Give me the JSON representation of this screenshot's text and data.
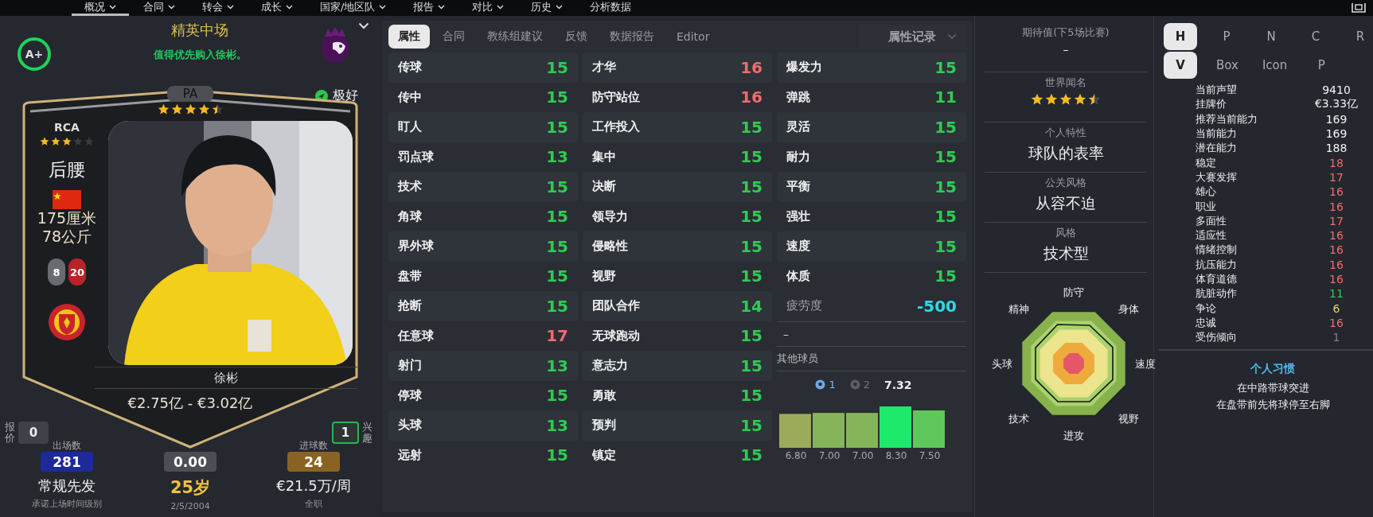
{
  "nav": [
    {
      "label": "概况",
      "selected": true,
      "dropdown": true
    },
    {
      "label": "合同",
      "selected": false,
      "dropdown": true
    },
    {
      "label": "转会",
      "selected": false,
      "dropdown": true
    },
    {
      "label": "成长",
      "selected": false,
      "dropdown": true
    },
    {
      "label": "国家/地区队",
      "selected": false,
      "dropdown": true
    },
    {
      "label": "报告",
      "selected": false,
      "dropdown": true
    },
    {
      "label": "对比",
      "selected": false,
      "dropdown": true
    },
    {
      "label": "历史",
      "selected": false,
      "dropdown": true
    },
    {
      "label": "分析数据",
      "selected": false,
      "dropdown": false
    }
  ],
  "player": {
    "grade": "A+",
    "role_title": "精英中场",
    "recommendation": "值得优先购入徐彬。",
    "pa": {
      "label": "PA",
      "stars": 4.5
    },
    "scout_rating": "极好",
    "position_rating": {
      "code": "RCA",
      "stars": 3
    },
    "position": "后腰",
    "height": "175厘米",
    "weight": "78公斤",
    "numbers": [
      {
        "value": "8",
        "color": "#6a6b70"
      },
      {
        "value": "20",
        "color": "#b82228"
      }
    ],
    "name": "徐彬",
    "value_range": "€2.75亿 - €3.02亿",
    "offers": {
      "label": "报价",
      "value": "0"
    },
    "interest": {
      "label": "兴趣",
      "value": "1"
    },
    "stats": [
      {
        "caption": "出场数",
        "badge": "281",
        "color": "#1d2a98",
        "main": "常规先发",
        "highlight": false,
        "sub": "承诺上场时间级别"
      },
      {
        "badge": "0.00",
        "color": "#4b4e55",
        "main": "25岁",
        "highlight": true,
        "sub": "2/5/2004"
      },
      {
        "caption": "进球数",
        "badge": "24",
        "color": "#8a6322",
        "main": "€21.5万/周",
        "highlight": false,
        "sub": "全职"
      }
    ]
  },
  "tabs": [
    {
      "label": "属性",
      "selected": true
    },
    {
      "label": "合同",
      "selected": false
    },
    {
      "label": "教练组建议",
      "selected": false
    },
    {
      "label": "反馈",
      "selected": false
    },
    {
      "label": "数据报告",
      "selected": false
    },
    {
      "label": "Editor",
      "selected": false
    }
  ],
  "history_dropdown": "属性记录",
  "attribute_columns": [
    [
      {
        "label": "传球",
        "value": "15"
      },
      {
        "label": "传中",
        "value": "15"
      },
      {
        "label": "盯人",
        "value": "15"
      },
      {
        "label": "罚点球",
        "value": "13"
      },
      {
        "label": "技术",
        "value": "15"
      },
      {
        "label": "角球",
        "value": "15"
      },
      {
        "label": "界外球",
        "value": "15"
      },
      {
        "label": "盘带",
        "value": "15"
      },
      {
        "label": "抢断",
        "value": "15"
      },
      {
        "label": "任意球",
        "value": "17"
      },
      {
        "label": "射门",
        "value": "13"
      },
      {
        "label": "停球",
        "value": "15"
      },
      {
        "label": "头球",
        "value": "13"
      },
      {
        "label": "远射",
        "value": "15"
      }
    ],
    [
      {
        "label": "才华",
        "value": "16"
      },
      {
        "label": "防守站位",
        "value": "16"
      },
      {
        "label": "工作投入",
        "value": "15"
      },
      {
        "label": "集中",
        "value": "15"
      },
      {
        "label": "决断",
        "value": "15"
      },
      {
        "label": "领导力",
        "value": "15"
      },
      {
        "label": "侵略性",
        "value": "15"
      },
      {
        "label": "视野",
        "value": "15"
      },
      {
        "label": "团队合作",
        "value": "14"
      },
      {
        "label": "无球跑动",
        "value": "15"
      },
      {
        "label": "意志力",
        "value": "15"
      },
      {
        "label": "勇敢",
        "value": "15"
      },
      {
        "label": "预判",
        "value": "15"
      },
      {
        "label": "镇定",
        "value": "15"
      }
    ],
    [
      {
        "label": "爆发力",
        "value": "15"
      },
      {
        "label": "弹跳",
        "value": "11"
      },
      {
        "label": "灵活",
        "value": "15"
      },
      {
        "label": "耐力",
        "value": "15"
      },
      {
        "label": "平衡",
        "value": "15"
      },
      {
        "label": "强壮",
        "value": "15"
      },
      {
        "label": "速度",
        "value": "15"
      },
      {
        "label": "体质",
        "value": "15"
      }
    ]
  ],
  "fatigue": {
    "label": "疲劳度",
    "value": "-500"
  },
  "recent_form": "–",
  "other_players": "其他球员",
  "ratings": {
    "player_of_match": "1",
    "second": "2",
    "average": "7.32",
    "recent_ratings": [
      "6.80",
      "7.00",
      "7.00",
      "8.30",
      "7.50"
    ]
  },
  "profile": [
    {
      "kind": "text",
      "title": "期待值(下5场比赛)",
      "value": "–"
    },
    {
      "kind": "stars",
      "title": "世界闻名",
      "stars": 4.5
    },
    {
      "kind": "text",
      "title": "个人特性",
      "value": "球队的表率"
    },
    {
      "kind": "text",
      "title": "公关风格",
      "value": "从容不迫"
    },
    {
      "kind": "text",
      "title": "风格",
      "value": "技术型"
    }
  ],
  "radar": {
    "labels": [
      "防守",
      "身体",
      "速度",
      "视野",
      "进攻",
      "技术",
      "头球",
      "精神"
    ]
  },
  "toggle_rows": [
    [
      {
        "label": "H",
        "selected": true
      },
      {
        "label": "P",
        "selected": false
      },
      {
        "label": "N",
        "selected": false
      },
      {
        "label": "C",
        "selected": false
      },
      {
        "label": "R",
        "selected": false
      }
    ],
    [
      {
        "label": "V",
        "selected": true
      },
      {
        "label": "Box",
        "selected": false
      },
      {
        "label": "Icon",
        "selected": false
      },
      {
        "label": "P",
        "selected": false
      }
    ]
  ],
  "details": [
    {
      "label": "当前声望",
      "value": "9410",
      "kind": "info"
    },
    {
      "label": "挂牌价",
      "value": "€3.33亿",
      "kind": "info"
    },
    {
      "label": "推荐当前能力",
      "value": "169",
      "kind": "info"
    },
    {
      "label": "当前能力",
      "value": "169",
      "kind": "info"
    },
    {
      "label": "潜在能力",
      "value": "188",
      "kind": "info"
    },
    {
      "label": "稳定",
      "value": "18",
      "kind": "attr"
    },
    {
      "label": "大赛发挥",
      "value": "17",
      "kind": "attr"
    },
    {
      "label": "雄心",
      "value": "16",
      "kind": "attr"
    },
    {
      "label": "职业",
      "value": "16",
      "kind": "attr"
    },
    {
      "label": "多面性",
      "value": "17",
      "kind": "attr"
    },
    {
      "label": "适应性",
      "value": "16",
      "kind": "attr"
    },
    {
      "label": "情绪控制",
      "value": "16",
      "kind": "attr"
    },
    {
      "label": "抗压能力",
      "value": "16",
      "kind": "attr"
    },
    {
      "label": "体育道德",
      "value": "16",
      "kind": "attr"
    },
    {
      "label": "肮脏动作",
      "value": "11",
      "kind": "attr"
    },
    {
      "label": "争论",
      "value": "6",
      "kind": "attr"
    },
    {
      "label": "忠诚",
      "value": "16",
      "kind": "attr"
    },
    {
      "label": "受伤倾向",
      "value": "1",
      "kind": "attr"
    }
  ],
  "habits": {
    "title": "个人习惯",
    "items": [
      "在中路带球突进",
      "在盘带前先将球停至右脚"
    ]
  }
}
